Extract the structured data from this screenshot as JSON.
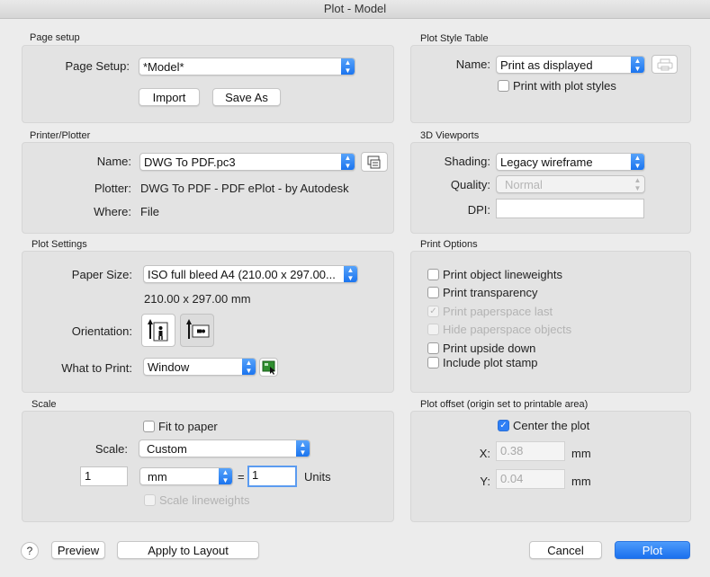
{
  "window": {
    "title": "Plot - Model"
  },
  "page_setup": {
    "section_title": "Page setup",
    "label": "Page Setup:",
    "value": "*Model*",
    "import_label": "Import",
    "save_as_label": "Save As"
  },
  "plot_style_table": {
    "section_title": "Plot Style Table",
    "name_label": "Name:",
    "name_value": "Print as displayed",
    "print_with_styles_label": "Print with plot styles",
    "print_with_styles_checked": false
  },
  "printer": {
    "section_title": "Printer/Plotter",
    "name_label": "Name:",
    "name_value": "DWG To PDF.pc3",
    "plotter_label": "Plotter:",
    "plotter_value": "DWG To PDF - PDF ePlot - by Autodesk",
    "where_label": "Where:",
    "where_value": "File"
  },
  "viewports_3d": {
    "section_title": "3D Viewports",
    "shading_label": "Shading:",
    "shading_value": "Legacy wireframe",
    "quality_label": "Quality:",
    "quality_value": "Normal",
    "dpi_label": "DPI:",
    "dpi_value": ""
  },
  "plot_settings": {
    "section_title": "Plot Settings",
    "paper_size_label": "Paper Size:",
    "paper_size_value": "ISO full bleed A4 (210.00 x 297.00...",
    "paper_dimensions": "210.00 x 297.00 mm",
    "orientation_label": "Orientation:",
    "what_to_print_label": "What to Print:",
    "what_to_print_value": "Window"
  },
  "print_options": {
    "section_title": "Print Options",
    "items": [
      {
        "label": "Print object lineweights",
        "checked": false,
        "enabled": true
      },
      {
        "label": "Print transparency",
        "checked": false,
        "enabled": true
      },
      {
        "label": "Print paperspace last",
        "checked": true,
        "enabled": false
      },
      {
        "label": "Hide paperspace objects",
        "checked": false,
        "enabled": false
      },
      {
        "label": "Print upside down",
        "checked": false,
        "enabled": true
      },
      {
        "label": "Include plot stamp",
        "checked": false,
        "enabled": true
      }
    ]
  },
  "scale": {
    "section_title": "Scale",
    "fit_to_paper_label": "Fit to paper",
    "fit_to_paper_checked": false,
    "scale_label": "Scale:",
    "scale_value": "Custom",
    "left_value": "1",
    "unit_value": "mm",
    "equals": "=",
    "right_value": "1",
    "units_label": "Units",
    "scale_lineweights_label": "Scale lineweights",
    "scale_lineweights_checked": false
  },
  "plot_offset": {
    "section_title": "Plot offset (origin set to printable area)",
    "center_label": "Center the plot",
    "center_checked": true,
    "x_label": "X:",
    "x_value": "0.38",
    "x_unit": "mm",
    "y_label": "Y:",
    "y_value": "0.04",
    "y_unit": "mm"
  },
  "footer": {
    "help_label": "?",
    "preview_label": "Preview",
    "apply_label": "Apply to Layout",
    "cancel_label": "Cancel",
    "plot_label": "Plot"
  },
  "colors": {
    "accent": "#1a70ee",
    "panel": "#e3e3e3",
    "background": "#ececec"
  }
}
